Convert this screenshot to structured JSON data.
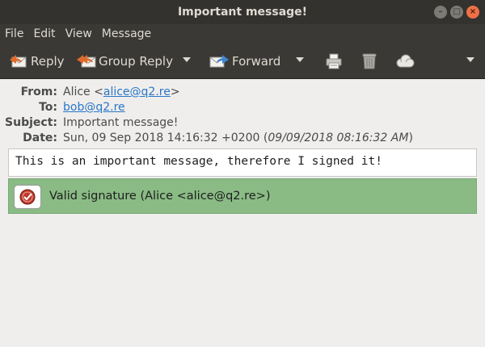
{
  "window": {
    "title": "Important message!"
  },
  "menu": [
    "File",
    "Edit",
    "View",
    "Message"
  ],
  "toolbar": {
    "reply": "Reply",
    "group_reply": "Group Reply",
    "forward": "Forward",
    "icons": [
      "reply-icon",
      "group-reply-icon",
      "forward-icon",
      "print-icon",
      "trash-icon",
      "cloud-icon",
      "overflow-menu-icon"
    ]
  },
  "headers": {
    "from_label": "From:",
    "from_name": "Alice <",
    "from_email": "alice@q2.re",
    "from_close": ">",
    "to_label": "To:",
    "to_email": "bob@q2.re",
    "subject_label": "Subject:",
    "subject": "Important message!",
    "date_label": "Date:",
    "date": "Sun, 09 Sep 2018 14:16:32 +0200 (",
    "date_local": "09/09/2018 08:16:32 AM",
    "date_close": ")"
  },
  "message": {
    "body": "This is an important message, therefore I signed it!"
  },
  "signature": {
    "status": "Valid signature (Alice <alice@q2.re>)",
    "color": "#8abb85"
  }
}
